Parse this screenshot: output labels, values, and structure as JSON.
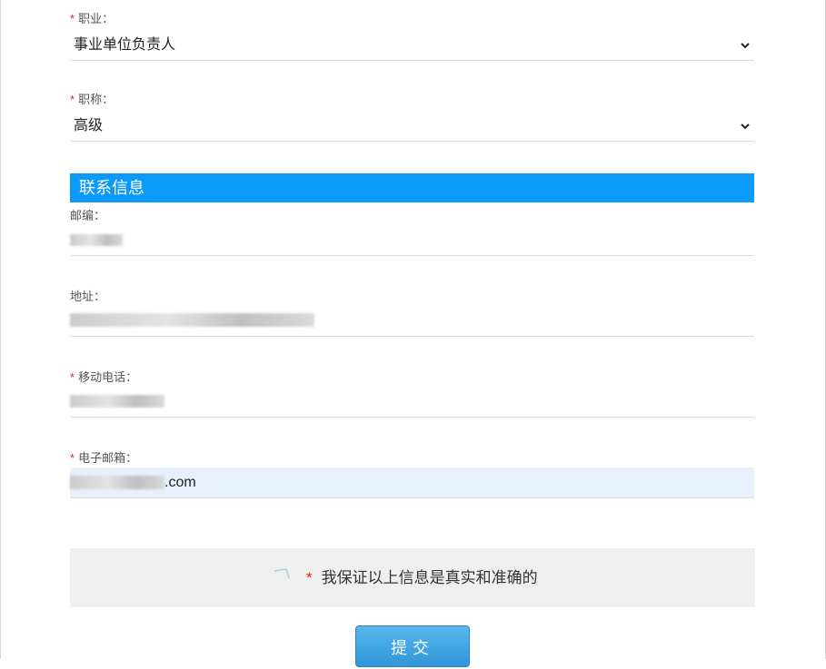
{
  "required_mark": "*",
  "fields": {
    "occupation": {
      "label": "职业：",
      "value": "事业单位负责人",
      "icon": "chevron-down-icon"
    },
    "title": {
      "label": "职称：",
      "value": "高级",
      "icon": "chevron-down-icon"
    },
    "postcode": {
      "label": "邮编："
    },
    "address": {
      "label": "地址："
    },
    "mobile": {
      "label": "移动电话："
    },
    "email": {
      "label": "电子邮箱：",
      "value_suffix": ".com"
    }
  },
  "section": {
    "contact_title": "联系信息"
  },
  "agreement": {
    "text": "我保证以上信息是真实和准确的",
    "icon": "checkbox-icon"
  },
  "submit": {
    "label": "提交"
  },
  "colors": {
    "accent": "#0a9bfa",
    "required": "#e02020",
    "button": "#3a9fe0",
    "autofill": "#e8f0fe"
  }
}
